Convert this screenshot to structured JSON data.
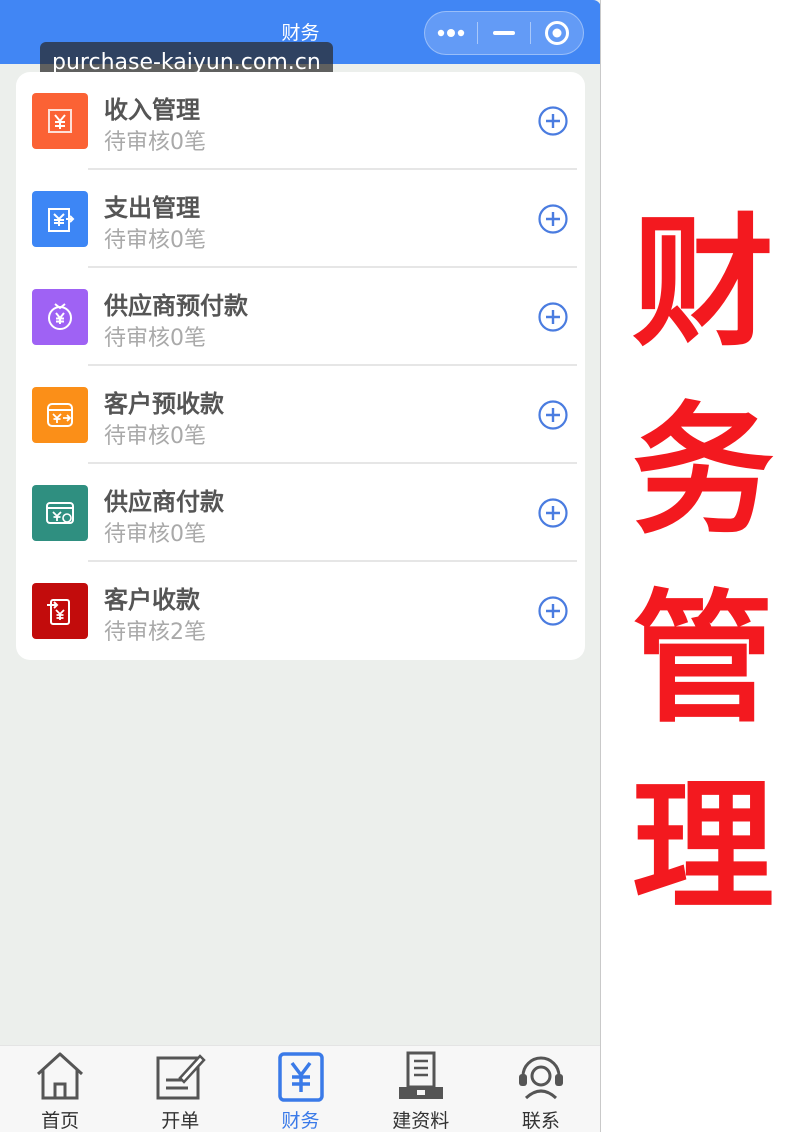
{
  "watermark": "purchase-kaiyun.com.cn",
  "header": {
    "title": "财务",
    "color": "#4186f4"
  },
  "capsule": {
    "more_icon": "more-dots-icon",
    "minimize_icon": "minimize-icon",
    "close_icon": "target-close-icon"
  },
  "items": [
    {
      "title": "收入管理",
      "subtitle": "待审核0笔",
      "icon": "income-icon",
      "color": "#fb6235"
    },
    {
      "title": "支出管理",
      "subtitle": "待审核0笔",
      "icon": "expense-icon",
      "color": "#3d86f5"
    },
    {
      "title": "供应商预付款",
      "subtitle": "待审核0笔",
      "icon": "supplier-prepayment-icon",
      "color": "#9f62f4"
    },
    {
      "title": "客户预收款",
      "subtitle": "待审核0笔",
      "icon": "customer-advance-icon",
      "color": "#fb8f18"
    },
    {
      "title": "供应商付款",
      "subtitle": "待审核0笔",
      "icon": "supplier-payment-icon",
      "color": "#2f8f80"
    },
    {
      "title": "客户收款",
      "subtitle": "待审核2笔",
      "icon": "customer-receipt-icon",
      "color": "#c20c0c"
    }
  ],
  "tabs": [
    {
      "label": "首页",
      "icon": "home-icon",
      "active": false
    },
    {
      "label": "开单",
      "icon": "create-order-icon",
      "active": false
    },
    {
      "label": "财务",
      "icon": "finance-yen-icon",
      "active": true
    },
    {
      "label": "建资料",
      "icon": "archive-icon",
      "active": false
    },
    {
      "label": "联系",
      "icon": "customer-service-icon",
      "active": false
    }
  ],
  "banner": {
    "chars": [
      "财",
      "务",
      "管",
      "理"
    ],
    "color": "#f3191f"
  },
  "accent": "#4a7ce0"
}
